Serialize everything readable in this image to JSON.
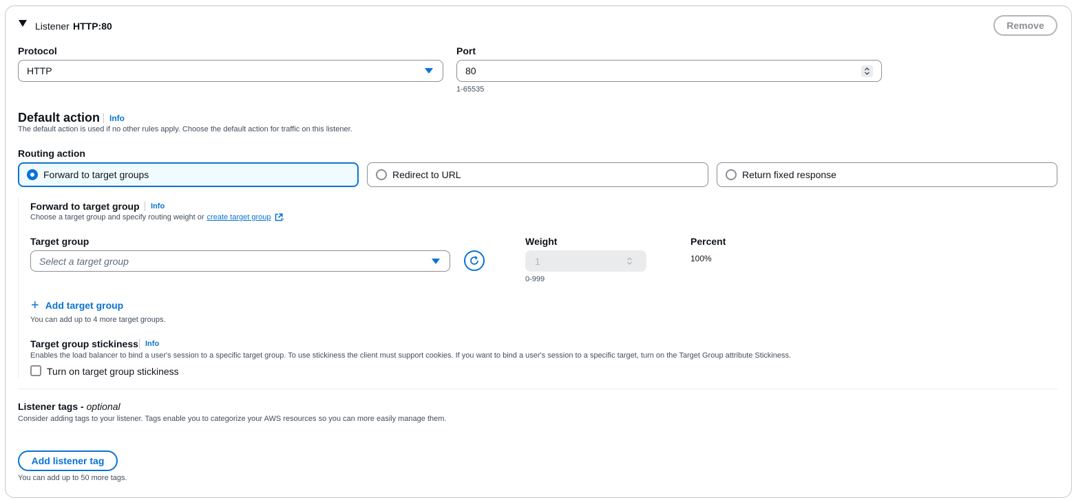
{
  "header": {
    "label": "Listener",
    "value": "HTTP:80",
    "remove_label": "Remove"
  },
  "protocol": {
    "label": "Protocol",
    "selected": "HTTP"
  },
  "port": {
    "label": "Port",
    "value": "80",
    "hint": "1-65535"
  },
  "default_action": {
    "title": "Default action",
    "info": "Info",
    "description": "The default action is used if no other rules apply. Choose the default action for traffic on this listener."
  },
  "routing_action": {
    "label": "Routing action",
    "options": [
      {
        "label": "Forward to target groups",
        "selected": true
      },
      {
        "label": "Redirect to URL",
        "selected": false
      },
      {
        "label": "Return fixed response",
        "selected": false
      }
    ]
  },
  "forward": {
    "title": "Forward to target group",
    "info": "Info",
    "description_pre": "Choose a target group and specify routing weight or",
    "link": "create target group",
    "description_post": "."
  },
  "target_group": {
    "label": "Target group",
    "placeholder": "Select a target group"
  },
  "weight": {
    "label": "Weight",
    "value": "1",
    "hint": "0-999"
  },
  "percent": {
    "label": "Percent",
    "value": "100%"
  },
  "add_target_group": {
    "label": "Add target group",
    "hint": "You can add up to 4 more target groups."
  },
  "stickiness": {
    "title": "Target group stickiness",
    "info": "Info",
    "description": "Enables the load balancer to bind a user's session to a specific target group. To use stickiness the client must support cookies. If you want to bind a user's session to a specific target, turn on the Target Group attribute Stickiness.",
    "checkbox_label": "Turn on target group stickiness",
    "checked": false
  },
  "tags": {
    "title": "Listener tags - ",
    "title_optional": "optional",
    "description": "Consider adding tags to your listener. Tags enable you to categorize your AWS resources so you can more easily manage them.",
    "button": "Add listener tag",
    "hint": "You can add up to 50 more tags."
  },
  "colors": {
    "accent": "#0972d3",
    "text": "#0f141a",
    "border": "#8c8c94"
  }
}
